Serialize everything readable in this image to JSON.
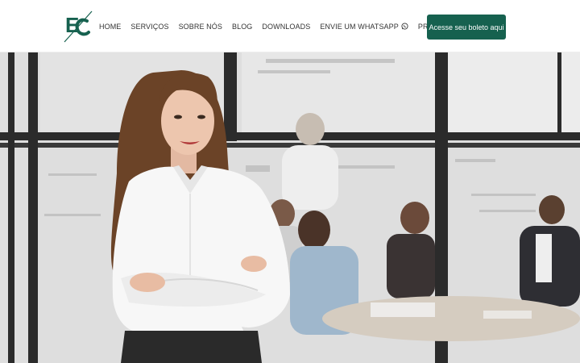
{
  "brand": {
    "logo_text": "EC"
  },
  "nav": {
    "items": [
      {
        "label": "HOME"
      },
      {
        "label": "SERVIÇOS"
      },
      {
        "label": "SOBRE NÓS"
      },
      {
        "label": "BLOG"
      },
      {
        "label": "DOWNLOADS"
      },
      {
        "label": "ENVIE UM WHATSAPP",
        "icon": "whatsapp-icon"
      },
      {
        "label": "PROPOSTA"
      }
    ]
  },
  "cta": {
    "label": "Acesse seu boleto aqui"
  },
  "colors": {
    "primary": "#16614f",
    "nav_text": "#333333"
  }
}
